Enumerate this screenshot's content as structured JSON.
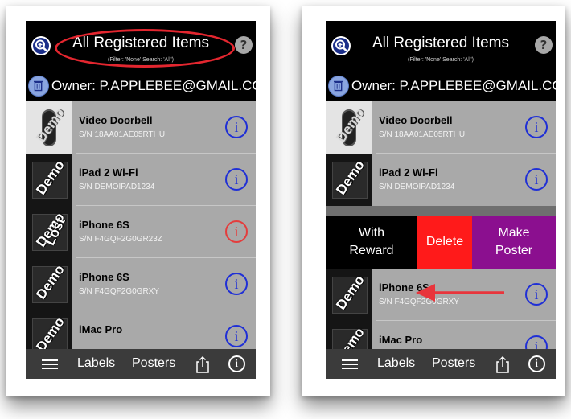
{
  "header": {
    "title": "All Registered Items",
    "subtitle": "(Filter: 'None' Search: 'All')",
    "help_glyph": "?"
  },
  "owner": {
    "label": "Owner: P.APPLEBEE@GMAIL.COM"
  },
  "badges": {
    "demo": "Demo",
    "lost": "Lost"
  },
  "left_items": [
    {
      "name": "Video Doorbell",
      "serial": "S/N 18AA01AE05RTHU",
      "status": "normal"
    },
    {
      "name": "iPad 2 Wi-Fi",
      "serial": "S/N DEMOIPAD1234",
      "status": "normal"
    },
    {
      "name": "iPhone 6S",
      "serial": "S/N F4GQF2G0GR23Z",
      "status": "lost"
    },
    {
      "name": "iPhone 6S",
      "serial": "S/N F4GQF2G0GRXY",
      "status": "normal"
    },
    {
      "name": "iMac Pro",
      "serial": "",
      "status": "normal"
    }
  ],
  "right_items": [
    {
      "name": "Video Doorbell",
      "serial": "S/N 18AA01AE05RTHU"
    },
    {
      "name": "iPad 2 Wi-Fi",
      "serial": "S/N DEMOIPAD1234"
    },
    {
      "name": "iPhone 6S",
      "serial": "S/N F4GQF2G0GRXY"
    },
    {
      "name": "iMac Pro",
      "serial": ""
    }
  ],
  "swipe_actions": {
    "reward": "With Reward",
    "delete": "Delete",
    "poster": "Make Poster"
  },
  "toolbar": {
    "labels": "Labels",
    "posters": "Posters",
    "info_glyph": "i"
  },
  "info_glyph": "i",
  "colors": {
    "info_blue": "#1f2fd6",
    "lost_red": "#e43c3c",
    "delete_red": "#ff1a1a",
    "poster_purple": "#8b0f8f",
    "highlight_red": "#e3262f"
  },
  "icons": {
    "search": "zoom-icon",
    "trash": "trash-icon",
    "menu": "hamburger-icon",
    "share": "share-icon",
    "info": "info-icon"
  }
}
